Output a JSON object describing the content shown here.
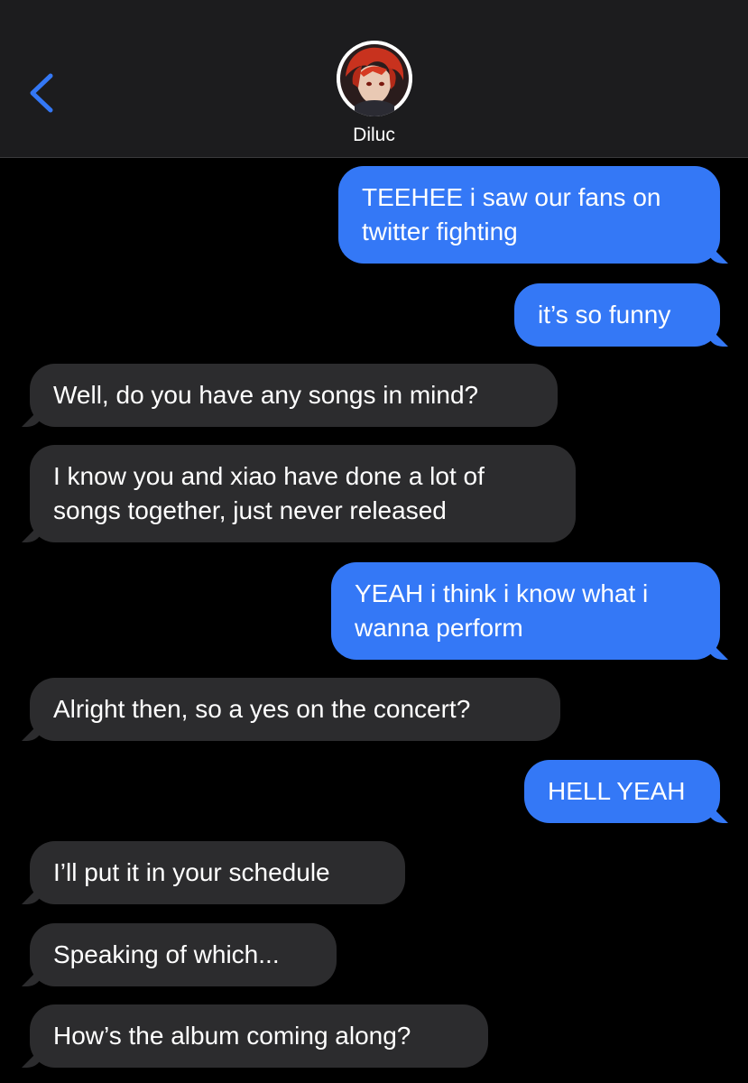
{
  "header": {
    "contact_name": "Diluc",
    "back_icon": "chevron-left-icon",
    "avatar": "contact-avatar",
    "accent_color": "#3478f6"
  },
  "messages": [
    {
      "direction": "sent",
      "text": "TEEHEE i saw our fans on\ntwitter fighting"
    },
    {
      "direction": "sent",
      "text": "it’s so funny"
    },
    {
      "direction": "received",
      "text": "Well, do you have any songs in mind?"
    },
    {
      "direction": "received",
      "text": "I know you and xiao have done a lot of\nsongs together, just never released"
    },
    {
      "direction": "sent",
      "text": "YEAH i think i know what i\nwanna perform"
    },
    {
      "direction": "received",
      "text": "Alright then, so a yes on the concert?"
    },
    {
      "direction": "sent",
      "text": "HELL YEAH"
    },
    {
      "direction": "received",
      "text": "I’ll put it in your schedule"
    },
    {
      "direction": "received",
      "text": "Speaking of which..."
    },
    {
      "direction": "received",
      "text": "How’s the album coming along?"
    }
  ],
  "colors": {
    "sent_bubble": "#3478f6",
    "received_bubble": "#2c2c2e",
    "header_bg": "#1c1c1e",
    "background": "#000000"
  }
}
